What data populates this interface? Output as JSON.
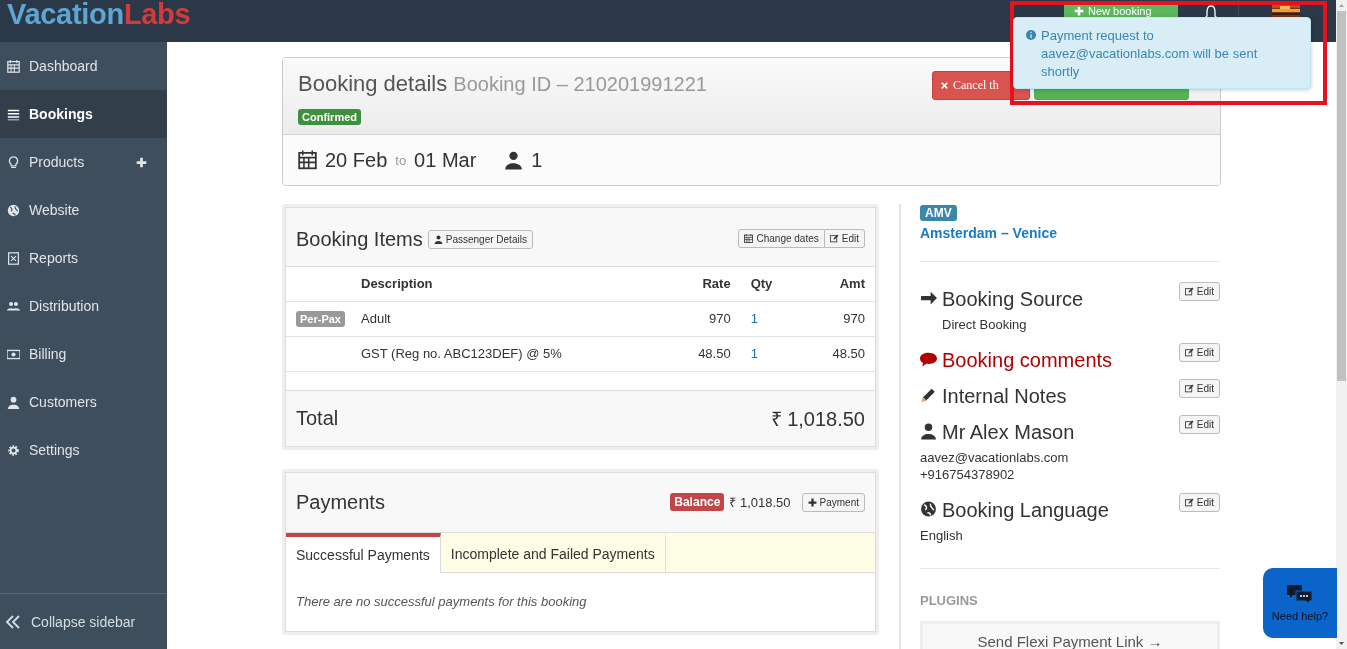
{
  "app": {
    "logo_primary": "Vacation",
    "logo_accent": "Labs",
    "new_booking": "New booking"
  },
  "sidebar": {
    "items": [
      {
        "label": "Dashboard",
        "selected": false,
        "expandable": false
      },
      {
        "label": "Bookings",
        "selected": true,
        "expandable": false
      },
      {
        "label": "Products",
        "selected": false,
        "expandable": true
      },
      {
        "label": "Website",
        "selected": false,
        "expandable": false
      },
      {
        "label": "Reports",
        "selected": false,
        "expandable": false
      },
      {
        "label": "Distribution",
        "selected": false,
        "expandable": false
      },
      {
        "label": "Billing",
        "selected": false,
        "expandable": false
      },
      {
        "label": "Customers",
        "selected": false,
        "expandable": false
      },
      {
        "label": "Settings",
        "selected": false,
        "expandable": false
      }
    ],
    "collapse": "Collapse sidebar"
  },
  "booking": {
    "title": "Booking details",
    "booking_id": "Booking ID – 210201991221",
    "status": {
      "label": "Confirmed",
      "kind": "confirmed"
    },
    "cancel_button": "Cancel th",
    "dates": {
      "start": "20 Feb",
      "to": "to",
      "end": "01 Mar"
    },
    "travellers": "1"
  },
  "items_panel": {
    "title": "Booking Items",
    "passenger_button": "Passenger Details",
    "change_dates_button": "Change dates",
    "edit_button": "Edit",
    "columns": [
      "Description",
      "Rate",
      "Qty",
      "Amt"
    ],
    "rows": [
      {
        "tag": "Per-Pax",
        "description": "Adult",
        "rate": "970",
        "qty": "1",
        "amount": "970"
      },
      {
        "description": "GST (Reg no. ABC123DEF) @ 5%",
        "rate": "48.50",
        "qty": "1",
        "amount": "48.50"
      }
    ],
    "total_label": "Total",
    "total": "₹ 1,018.50"
  },
  "payments": {
    "title": "Payments",
    "balance_label": "Balance",
    "balance": "₹ 1,018.50",
    "add_button": "Payment",
    "tabs": [
      {
        "label": "Successful Payments",
        "selected": true
      },
      {
        "label": "Incomplete and Failed Payments",
        "selected": false
      }
    ],
    "empty_message": "There are no successful payments for this booking"
  },
  "trip": {
    "code": "AMV",
    "name": "Amsterdam – Venice"
  },
  "sections": [
    {
      "kind": "source",
      "title": "Booking Source",
      "edit": "Edit",
      "lines": [
        "Direct Booking"
      ]
    },
    {
      "kind": "comments",
      "title": "Booking comments",
      "edit": "Edit"
    },
    {
      "kind": "notes",
      "title": "Internal Notes",
      "edit": "Edit"
    },
    {
      "kind": "customer",
      "title": "Mr Alex Mason",
      "edit": "Edit",
      "lines": [
        "aavez@vacationlabs.com",
        "+916754378902"
      ]
    },
    {
      "kind": "language",
      "title": "Booking Language",
      "edit": "Edit",
      "lines": [
        "English"
      ]
    }
  ],
  "plugins": {
    "title": "PLUGINS",
    "buttons": [
      "Send Flexi Payment Link →"
    ]
  },
  "toast": {
    "message": "Payment request to aavez@vacationlabs.com will be sent shortly"
  },
  "help": {
    "label": "Need help?"
  }
}
